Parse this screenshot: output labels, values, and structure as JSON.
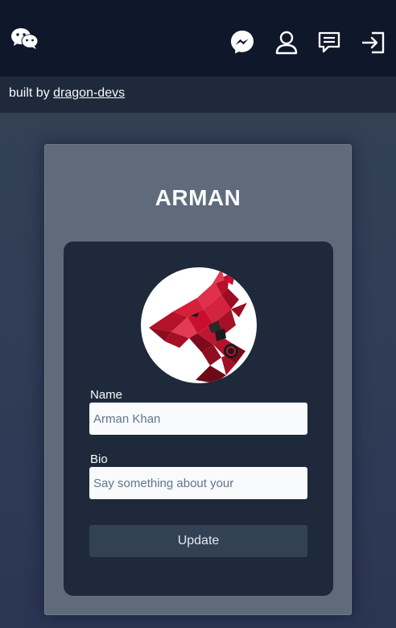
{
  "header": {
    "icons": [
      "wechat-icon",
      "messenger-icon",
      "user-icon",
      "message-icon",
      "login-icon"
    ]
  },
  "subheader": {
    "prefix": "built by",
    "link": "dragon-devs"
  },
  "profile": {
    "title": "ARMAN",
    "avatar": "dragon-avatar",
    "name_label": "Name",
    "name_value": "Arman Khan",
    "bio_label": "Bio",
    "bio_placeholder": "Say something about your",
    "update_label": "Update"
  },
  "colors": {
    "topbar": "#0f172a",
    "subbar": "#1e293b",
    "card": "#5f6b7b",
    "inner_panel": "#1e293b",
    "button": "#334155",
    "dragon_red": "#c8102e"
  }
}
